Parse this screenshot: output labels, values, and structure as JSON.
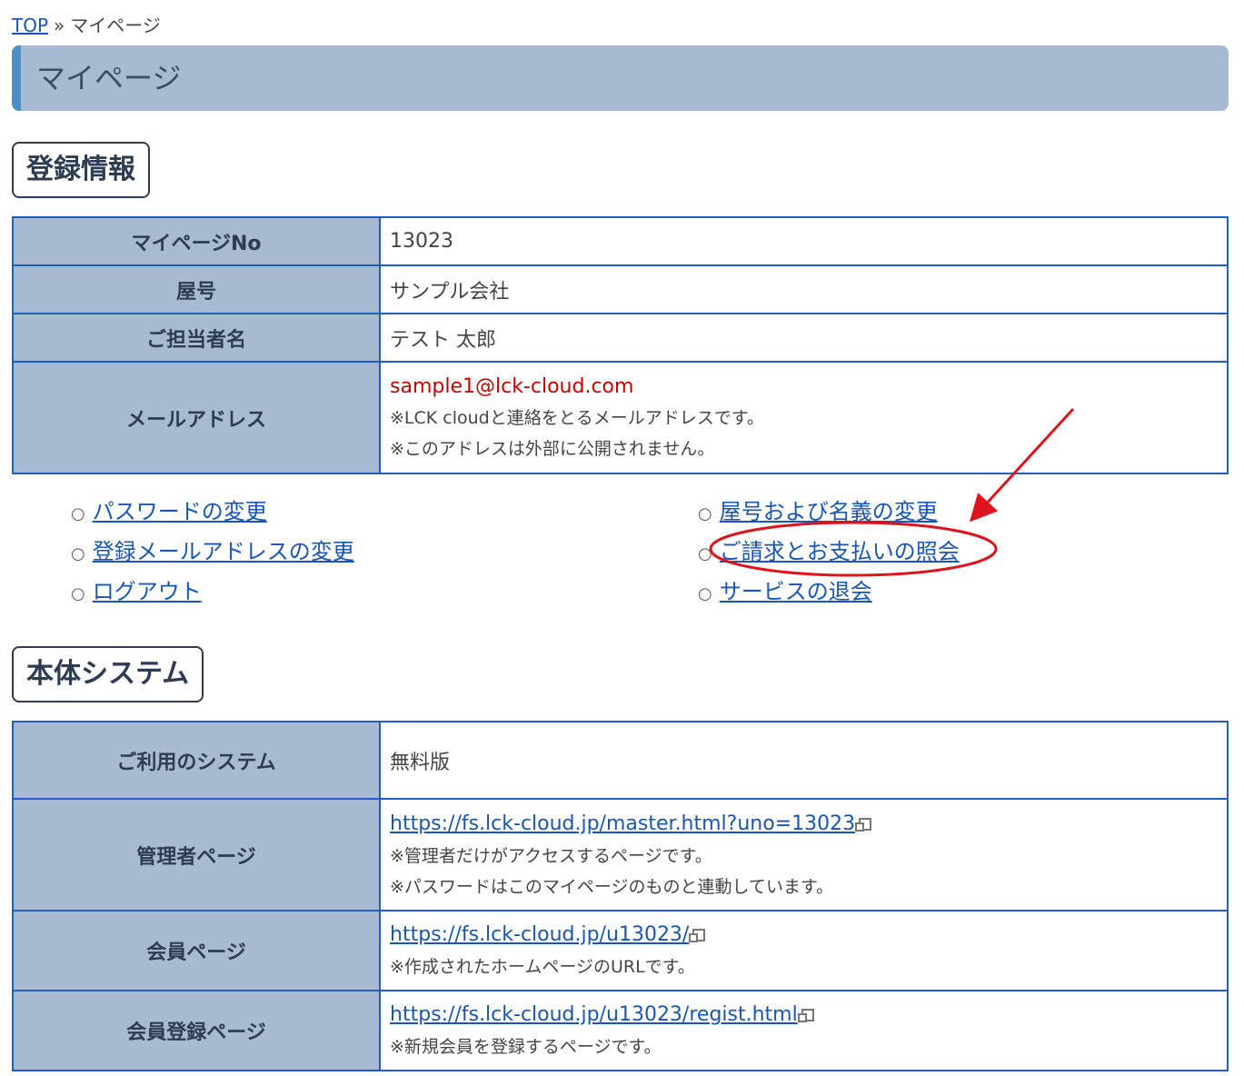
{
  "breadcrumb": {
    "top": "TOP",
    "separator": "»",
    "current": "マイページ"
  },
  "page_title": "マイページ",
  "section1": {
    "heading": "登録情報",
    "rows": [
      {
        "label": "マイページNo",
        "value": "13023"
      },
      {
        "label": "屋号",
        "value": "サンプル会社"
      },
      {
        "label": "ご担当者名",
        "value": "テスト 太郎"
      }
    ],
    "email_row": {
      "label": "メールアドレス",
      "value": "sample1@lck-cloud.com",
      "note1": "※LCK cloudと連絡をとるメールアドレスです。",
      "note2": "※このアドレスは外部に公開されません。"
    }
  },
  "links": {
    "bullet": "○",
    "left": [
      "パスワードの変更",
      "登録メールアドレスの変更",
      "ログアウト"
    ],
    "right": [
      "屋号および名義の変更",
      "ご請求とお支払いの照会",
      "サービスの退会"
    ]
  },
  "section2": {
    "heading": "本体システム",
    "system": {
      "label": "ご利用のシステム",
      "value": "無料版"
    },
    "admin": {
      "label": "管理者ページ",
      "url": "https://fs.lck-cloud.jp/master.html?uno=13023",
      "note1": "※管理者だけがアクセスするページです。",
      "note2": "※パスワードはこのマイページのものと連動しています。"
    },
    "member": {
      "label": "会員ページ",
      "url": "https://fs.lck-cloud.jp/u13023/",
      "note1": "※作成されたホームページのURLです。"
    },
    "register": {
      "label": "会員登録ページ",
      "url": "https://fs.lck-cloud.jp/u13023/regist.html",
      "note1": "※新規会員を登録するページです。"
    }
  },
  "colors": {
    "header_bg": "#a8b9d2",
    "accent": "#4a90c8",
    "border": "#1f5fc2",
    "link": "#1a55b8",
    "annotation": "#e0131d"
  }
}
